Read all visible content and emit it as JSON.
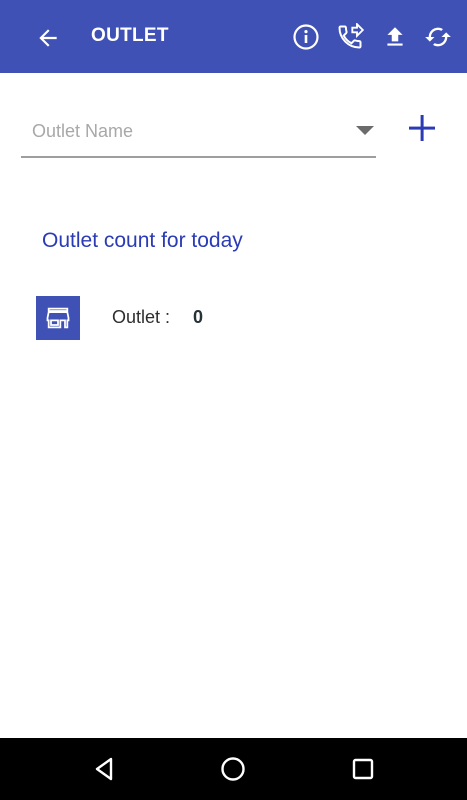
{
  "app_bar": {
    "title": "OUTLET",
    "background": "#3f51b5",
    "back_icon": "arrow-back-icon",
    "actions": [
      "info-icon",
      "phone-forwarded-icon",
      "upload-icon",
      "sync-icon"
    ]
  },
  "selector": {
    "placeholder": "Outlet Name",
    "dropdown_icon": "dropdown-caret-icon",
    "add_icon": "plus-icon"
  },
  "summary": {
    "heading": "Outlet count for today",
    "heading_color": "#2a3bb5",
    "item_icon": "store-icon",
    "label": "Outlet :",
    "value": "0"
  },
  "system_nav": {
    "buttons": [
      "back-triangle-icon",
      "home-circle-icon",
      "recents-square-icon"
    ]
  }
}
